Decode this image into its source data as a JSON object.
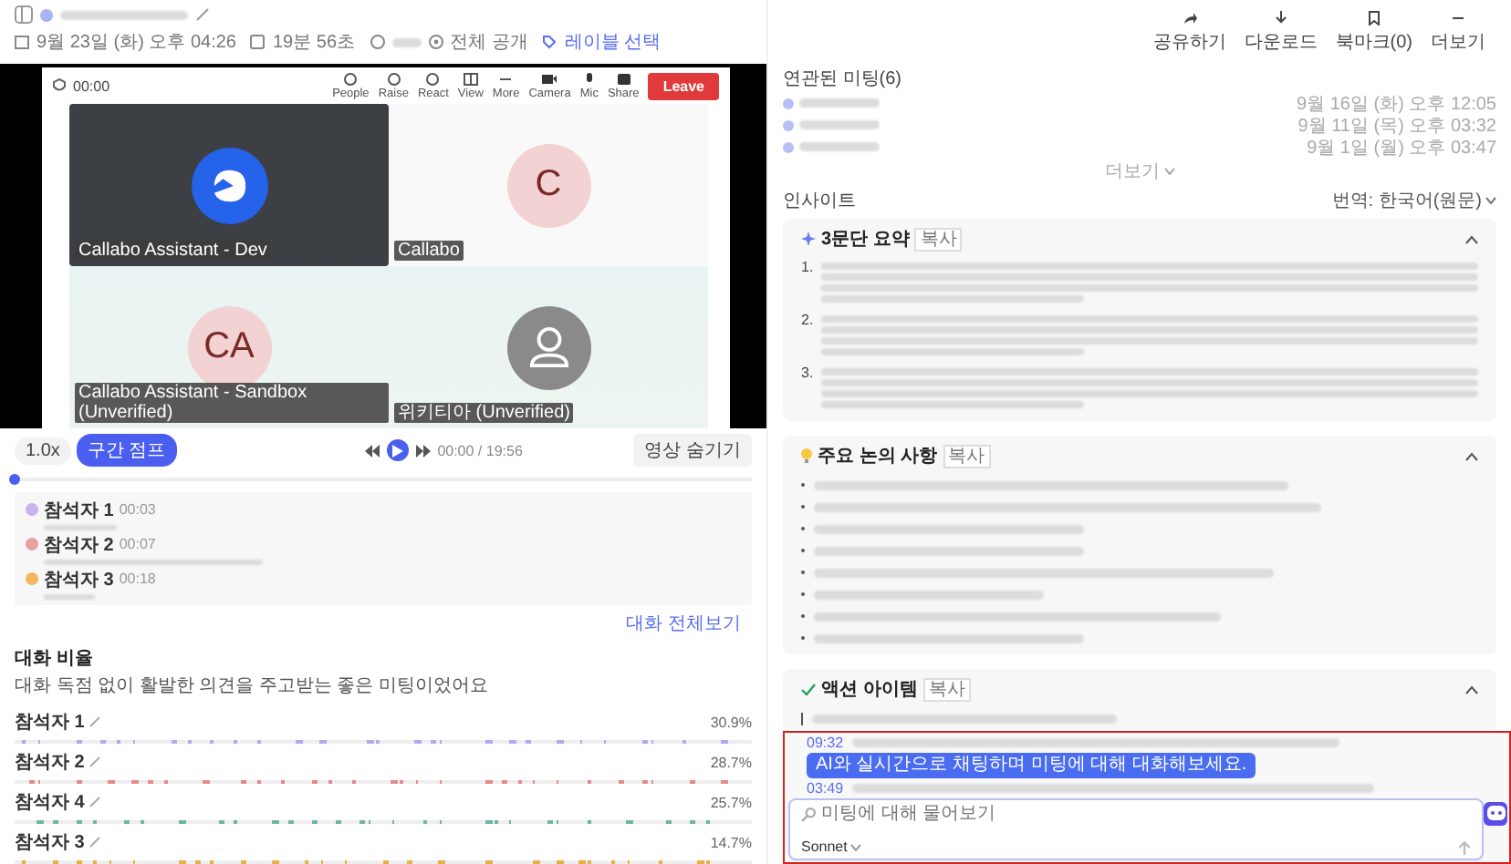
{
  "header": {
    "meta": [
      {
        "kind": "date",
        "text": "9월 23일 (화) 오후 04:26"
      },
      {
        "kind": "duration",
        "text": "19분 56초"
      },
      {
        "kind": "visibility",
        "text": "전체 공개"
      },
      {
        "kind": "label",
        "text": "레이블 선택"
      }
    ],
    "actions": [
      {
        "kind": "share",
        "label": "공유하기"
      },
      {
        "kind": "download",
        "label": "다운로드"
      },
      {
        "kind": "bookmark",
        "label": "북마크(0)"
      },
      {
        "kind": "more",
        "label": "더보기"
      }
    ]
  },
  "meeting": {
    "timer": "00:00",
    "tools": [
      {
        "kind": "people",
        "label": "People"
      },
      {
        "kind": "raise",
        "label": "Raise"
      },
      {
        "kind": "react",
        "label": "React"
      },
      {
        "kind": "view",
        "label": "View"
      },
      {
        "kind": "more",
        "label": "More"
      },
      {
        "kind": "camera",
        "label": "Camera"
      },
      {
        "kind": "mic",
        "label": "Mic"
      },
      {
        "kind": "share",
        "label": "Share"
      }
    ],
    "leave": "Leave",
    "tiles": [
      {
        "kind": "logo",
        "name": "Callabo Assistant - Dev"
      },
      {
        "kind": "initials",
        "initials": "C",
        "name": "Callabo"
      },
      {
        "kind": "initials",
        "initials": "CA",
        "name": "Callabo Assistant - Sandbox (Unverified)"
      },
      {
        "kind": "silhouette",
        "name": "위키티아 (Unverified)"
      }
    ]
  },
  "player": {
    "speed": "1.0x",
    "jump": "구간 점프",
    "time": "00:00 / 19:56",
    "hide": "영상 숨기기",
    "level": 0.0
  },
  "transcript": [
    {
      "speaker": "참석자 1",
      "time": "00:03",
      "color": "#c9b3f0"
    },
    {
      "speaker": "참석자 2",
      "time": "00:07",
      "color": "#eda0a0"
    },
    {
      "speaker": "참석자 3",
      "time": "00:18",
      "color": "#f0b860"
    }
  ],
  "transcript_link": "대화 전체보기",
  "ratio": {
    "title": "대화 비율",
    "subtitle": "대화 독점 없이 활발한 의견을 주고받는 좋은 미팅이었어요",
    "rows": [
      {
        "speaker": "참석자 1",
        "percent": "30.9%",
        "color": "#b9a4ee"
      },
      {
        "speaker": "참석자 2",
        "percent": "28.7%",
        "color": "#e58a8a"
      },
      {
        "speaker": "참석자 4",
        "percent": "25.7%",
        "color": "#6bb5a8"
      },
      {
        "speaker": "참석자 3",
        "percent": "14.7%",
        "color": "#e8b04a"
      }
    ]
  },
  "related": {
    "title": "연관된 미팅(6)",
    "dates": [
      "9월 16일 (화) 오후 12:05",
      "9월 11일 (목) 오후 03:32",
      "9월 1일 (월) 오후 03:47"
    ],
    "more": "더보기"
  },
  "insight": {
    "title": "인사이트",
    "translate": "번역: 한국어(원문)",
    "cards": [
      {
        "kind": "summary",
        "title": "3문단 요약",
        "copy": "복사",
        "expanded": true,
        "numbers": [
          "1.",
          "2.",
          "3."
        ]
      },
      {
        "kind": "discussion",
        "title": "주요 논의 사항",
        "copy": "복사",
        "expanded": true
      },
      {
        "kind": "action",
        "title": "액션 아이템",
        "copy": "복사",
        "expanded": true
      }
    ]
  },
  "chat": {
    "times": [
      "09:32",
      "03:49"
    ],
    "tooltip": "AI와 실시간으로 채팅하며 미팅에 대해 대화해보세요.",
    "placeholder": "미팅에 대해 물어보기",
    "model": "Sonnet"
  }
}
